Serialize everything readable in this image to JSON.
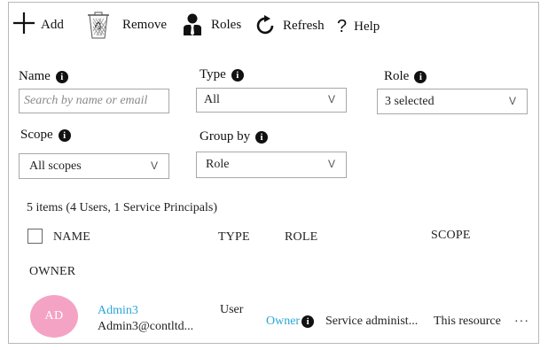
{
  "toolbar": {
    "add_label": "Add",
    "remove_label": "Remove",
    "roles_label": "Roles",
    "refresh_label": "Refresh",
    "help_label": "Help"
  },
  "filters": {
    "name": {
      "label": "Name",
      "placeholder": "Search by name or email"
    },
    "type": {
      "label": "Type",
      "value": "All"
    },
    "role": {
      "label": "Role",
      "value": "3 selected"
    },
    "scope": {
      "label": "Scope",
      "value": "All scopes"
    },
    "group_by": {
      "label": "Group by",
      "value": "Role"
    },
    "chevron": "V"
  },
  "summary": {
    "count_text": "5 items (4 Users, 1 Service Principals)"
  },
  "table": {
    "columns": {
      "name": "NAME",
      "type": "TYPE",
      "role": "ROLE",
      "scope": "SCOPE",
      "owner": "OWNER"
    },
    "rows": [
      {
        "avatar_initials": "AD",
        "avatar_color": "#f4a3c4",
        "name": "Admin3",
        "email": "Admin3@contltd...",
        "type": "User",
        "role": "Owner",
        "scope": "Service administ...",
        "owner": "This resource",
        "more": "···"
      }
    ]
  },
  "colors": {
    "link": "#2aa6d9",
    "border": "#b9b9b9"
  },
  "icons": [
    "plus-icon",
    "recycle-bin-icon",
    "user-tie-icon",
    "refresh-icon",
    "question-icon",
    "info-icon",
    "chevron-down-icon",
    "ellipsis-icon"
  ]
}
